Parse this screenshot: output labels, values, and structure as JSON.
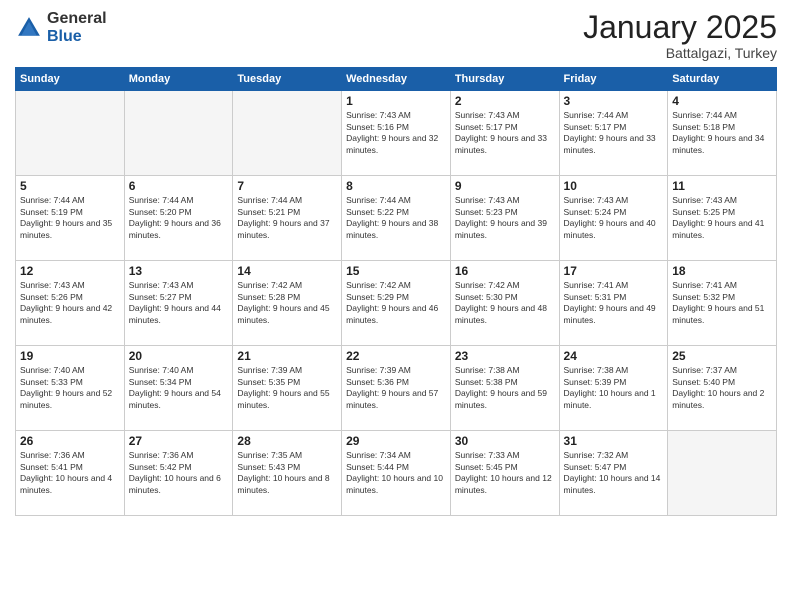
{
  "logo": {
    "general": "General",
    "blue": "Blue"
  },
  "title": "January 2025",
  "subtitle": "Battalgazi, Turkey",
  "days_of_week": [
    "Sunday",
    "Monday",
    "Tuesday",
    "Wednesday",
    "Thursday",
    "Friday",
    "Saturday"
  ],
  "weeks": [
    [
      {
        "day": "",
        "info": ""
      },
      {
        "day": "",
        "info": ""
      },
      {
        "day": "",
        "info": ""
      },
      {
        "day": "1",
        "info": "Sunrise: 7:43 AM\nSunset: 5:16 PM\nDaylight: 9 hours and 32 minutes."
      },
      {
        "day": "2",
        "info": "Sunrise: 7:43 AM\nSunset: 5:17 PM\nDaylight: 9 hours and 33 minutes."
      },
      {
        "day": "3",
        "info": "Sunrise: 7:44 AM\nSunset: 5:17 PM\nDaylight: 9 hours and 33 minutes."
      },
      {
        "day": "4",
        "info": "Sunrise: 7:44 AM\nSunset: 5:18 PM\nDaylight: 9 hours and 34 minutes."
      }
    ],
    [
      {
        "day": "5",
        "info": "Sunrise: 7:44 AM\nSunset: 5:19 PM\nDaylight: 9 hours and 35 minutes."
      },
      {
        "day": "6",
        "info": "Sunrise: 7:44 AM\nSunset: 5:20 PM\nDaylight: 9 hours and 36 minutes."
      },
      {
        "day": "7",
        "info": "Sunrise: 7:44 AM\nSunset: 5:21 PM\nDaylight: 9 hours and 37 minutes."
      },
      {
        "day": "8",
        "info": "Sunrise: 7:44 AM\nSunset: 5:22 PM\nDaylight: 9 hours and 38 minutes."
      },
      {
        "day": "9",
        "info": "Sunrise: 7:43 AM\nSunset: 5:23 PM\nDaylight: 9 hours and 39 minutes."
      },
      {
        "day": "10",
        "info": "Sunrise: 7:43 AM\nSunset: 5:24 PM\nDaylight: 9 hours and 40 minutes."
      },
      {
        "day": "11",
        "info": "Sunrise: 7:43 AM\nSunset: 5:25 PM\nDaylight: 9 hours and 41 minutes."
      }
    ],
    [
      {
        "day": "12",
        "info": "Sunrise: 7:43 AM\nSunset: 5:26 PM\nDaylight: 9 hours and 42 minutes."
      },
      {
        "day": "13",
        "info": "Sunrise: 7:43 AM\nSunset: 5:27 PM\nDaylight: 9 hours and 44 minutes."
      },
      {
        "day": "14",
        "info": "Sunrise: 7:42 AM\nSunset: 5:28 PM\nDaylight: 9 hours and 45 minutes."
      },
      {
        "day": "15",
        "info": "Sunrise: 7:42 AM\nSunset: 5:29 PM\nDaylight: 9 hours and 46 minutes."
      },
      {
        "day": "16",
        "info": "Sunrise: 7:42 AM\nSunset: 5:30 PM\nDaylight: 9 hours and 48 minutes."
      },
      {
        "day": "17",
        "info": "Sunrise: 7:41 AM\nSunset: 5:31 PM\nDaylight: 9 hours and 49 minutes."
      },
      {
        "day": "18",
        "info": "Sunrise: 7:41 AM\nSunset: 5:32 PM\nDaylight: 9 hours and 51 minutes."
      }
    ],
    [
      {
        "day": "19",
        "info": "Sunrise: 7:40 AM\nSunset: 5:33 PM\nDaylight: 9 hours and 52 minutes."
      },
      {
        "day": "20",
        "info": "Sunrise: 7:40 AM\nSunset: 5:34 PM\nDaylight: 9 hours and 54 minutes."
      },
      {
        "day": "21",
        "info": "Sunrise: 7:39 AM\nSunset: 5:35 PM\nDaylight: 9 hours and 55 minutes."
      },
      {
        "day": "22",
        "info": "Sunrise: 7:39 AM\nSunset: 5:36 PM\nDaylight: 9 hours and 57 minutes."
      },
      {
        "day": "23",
        "info": "Sunrise: 7:38 AM\nSunset: 5:38 PM\nDaylight: 9 hours and 59 minutes."
      },
      {
        "day": "24",
        "info": "Sunrise: 7:38 AM\nSunset: 5:39 PM\nDaylight: 10 hours and 1 minute."
      },
      {
        "day": "25",
        "info": "Sunrise: 7:37 AM\nSunset: 5:40 PM\nDaylight: 10 hours and 2 minutes."
      }
    ],
    [
      {
        "day": "26",
        "info": "Sunrise: 7:36 AM\nSunset: 5:41 PM\nDaylight: 10 hours and 4 minutes."
      },
      {
        "day": "27",
        "info": "Sunrise: 7:36 AM\nSunset: 5:42 PM\nDaylight: 10 hours and 6 minutes."
      },
      {
        "day": "28",
        "info": "Sunrise: 7:35 AM\nSunset: 5:43 PM\nDaylight: 10 hours and 8 minutes."
      },
      {
        "day": "29",
        "info": "Sunrise: 7:34 AM\nSunset: 5:44 PM\nDaylight: 10 hours and 10 minutes."
      },
      {
        "day": "30",
        "info": "Sunrise: 7:33 AM\nSunset: 5:45 PM\nDaylight: 10 hours and 12 minutes."
      },
      {
        "day": "31",
        "info": "Sunrise: 7:32 AM\nSunset: 5:47 PM\nDaylight: 10 hours and 14 minutes."
      },
      {
        "day": "",
        "info": ""
      }
    ]
  ]
}
